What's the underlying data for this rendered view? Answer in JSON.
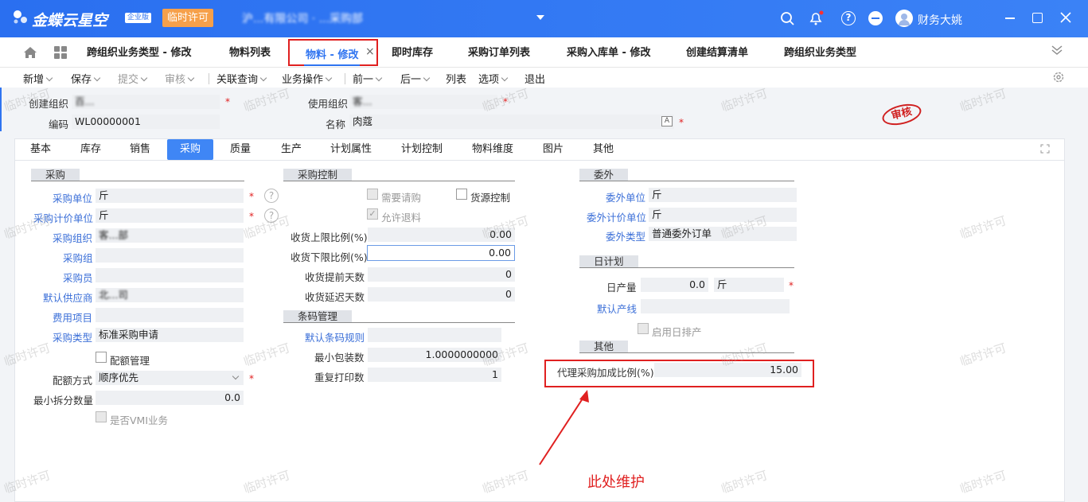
{
  "topbar": {
    "brand": "金蝶云星空",
    "edition_badge": "企业版",
    "license_badge": "临时许可",
    "org_display": "沪...有限公司 · ...采购部",
    "user_name": "财务大姚",
    "bg_color": "#2f74f0"
  },
  "tabs": [
    {
      "label": "跨组织业务类型 - 修改"
    },
    {
      "label": "物料列表"
    },
    {
      "label": "物料 - 修改",
      "active": true
    },
    {
      "label": "即时库存"
    },
    {
      "label": "采购订单列表"
    },
    {
      "label": "采购入库单 - 修改"
    },
    {
      "label": "创建结算清单"
    },
    {
      "label": "跨组织业务类型"
    }
  ],
  "toolbar": {
    "add": "新增",
    "save": "保存",
    "submit": "提交",
    "audit": "审核",
    "related": "关联查询",
    "business": "业务操作",
    "prev": "前一",
    "next": "后一",
    "list": "列表",
    "options": "选项",
    "exit": "退出"
  },
  "header": {
    "create_org_label": "创建组织",
    "create_org_value": "百...",
    "use_org_label": "使用组织",
    "use_org_value": "客...",
    "code_label": "编码",
    "code_value": "WL00000001",
    "name_label": "名称",
    "name_value": "肉蔻",
    "stamp": "审核"
  },
  "form_tabs": [
    "基本",
    "库存",
    "销售",
    "采购",
    "质量",
    "生产",
    "计划属性",
    "计划控制",
    "物料维度",
    "图片",
    "其他"
  ],
  "purchase": {
    "title": "采购",
    "unit_label": "采购单位",
    "unit_value": "斤",
    "price_unit_label": "采购计价单位",
    "price_unit_value": "斤",
    "org_label": "采购组织",
    "org_value": "客...部",
    "group_label": "采购组",
    "group_value": "",
    "buyer_label": "采购员",
    "buyer_value": "",
    "supplier_label": "默认供应商",
    "supplier_value": "北...司",
    "expense_label": "费用项目",
    "expense_value": "",
    "type_label": "采购类型",
    "type_value": "标准采购申请",
    "quota_label": "配额管理",
    "quota_mode_label": "配额方式",
    "quota_mode_value": "顺序优先",
    "min_split_label": "最小拆分数量",
    "min_split_value": "0.0",
    "vmi_label": "是否VMI业务"
  },
  "purchase_ctrl": {
    "title": "采购控制",
    "need_req_label": "需要请购",
    "source_ctrl_label": "货源控制",
    "allow_return_label": "允许退料",
    "upper_label": "收货上限比例(%)",
    "upper_value": "0.00",
    "lower_label": "收货下限比例(%)",
    "lower_value": "0.00",
    "advance_label": "收货提前天数",
    "advance_value": "0",
    "delay_label": "收货延迟天数",
    "delay_value": "0"
  },
  "barcode": {
    "title": "条码管理",
    "rule_label": "默认条码规则",
    "rule_value": "",
    "min_pack_label": "最小包装数",
    "min_pack_value": "1.0000000000",
    "reprint_label": "重复打印数",
    "reprint_value": "1"
  },
  "outsource": {
    "title": "委外",
    "unit_label": "委外单位",
    "unit_value": "斤",
    "price_unit_label": "委外计价单位",
    "price_unit_value": "斤",
    "type_label": "委外类型",
    "type_value": "普通委外订单"
  },
  "daily": {
    "title": "日计划",
    "output_label": "日产量",
    "output_value": "0.0",
    "output_unit": "斤",
    "line_label": "默认产线",
    "line_value": "",
    "enable_label": "启用日排产"
  },
  "other": {
    "title": "其他",
    "markup_label": "代理采购加成比例(%)",
    "markup_value": "15.00"
  },
  "annotation": {
    "text": "此处维护",
    "color": "#e02020"
  },
  "watermark": "临时许可"
}
